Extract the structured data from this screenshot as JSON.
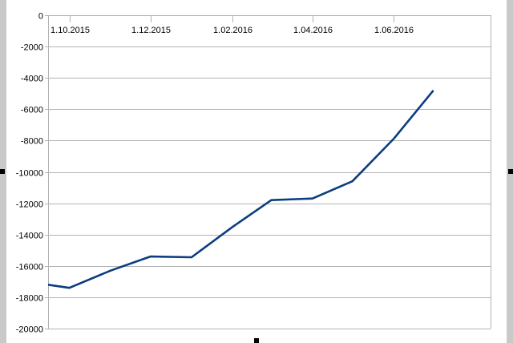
{
  "chart_data": {
    "type": "line",
    "title": "",
    "xlabel": "",
    "ylabel": "",
    "x_tick_labels": [
      "1.10.2015",
      "1.12.2015",
      "1.02.2016",
      "1.04.2016",
      "1.06.2016"
    ],
    "ylim": [
      -20000,
      0
    ],
    "y_step": 2000,
    "grid": true,
    "line_color": "#0b3d80",
    "series": [
      {
        "x": [
          "2015-09-15",
          "2015-10-01",
          "2015-11-01",
          "2015-12-01",
          "2016-01-01",
          "2016-02-01",
          "2016-03-01",
          "2016-04-01",
          "2016-05-01",
          "2016-06-01",
          "2016-07-01"
        ],
        "values": [
          -17200,
          -17400,
          -16300,
          -15400,
          -15450,
          -13500,
          -11800,
          -11700,
          -10600,
          -7900,
          -4800
        ]
      }
    ]
  }
}
